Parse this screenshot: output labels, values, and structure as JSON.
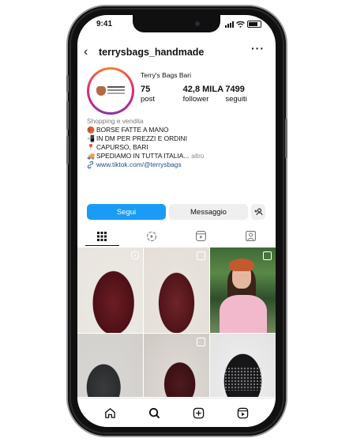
{
  "status_bar": {
    "time": "9:41"
  },
  "header": {
    "username": "terrysbags_handmade",
    "back_glyph": "‹",
    "more_glyph": "···"
  },
  "profile": {
    "display_name": "Terry's Bags Bari",
    "stats": [
      {
        "value": "75",
        "label": "post"
      },
      {
        "value": "42,8 MILA",
        "label": "follower"
      },
      {
        "value": "7499",
        "label": "seguiti"
      }
    ]
  },
  "bio": {
    "category": "Shopping e vendita",
    "lines": [
      {
        "emoji": "🏀",
        "text": "BORSE FATTE A MANO"
      },
      {
        "emoji": "📲",
        "text": "IN DM PER PREZZI E ORDINI"
      },
      {
        "emoji": "📍",
        "text": "CAPURSO, BARI"
      },
      {
        "emoji": "🚚",
        "text": "SPEDIAMO IN TUTTA ITALIA..."
      }
    ],
    "more_label": "altro",
    "link": "www.tiktok.com/@terrysbags"
  },
  "actions": {
    "follow": "Segui",
    "message": "Messaggio",
    "add_user": "+8"
  },
  "tabs": [
    "grid-icon",
    "reels-icon",
    "video-icon",
    "tagged-icon"
  ],
  "nav": [
    "home-icon",
    "search-icon",
    "create-icon",
    "reels-icon"
  ],
  "colors": {
    "accent": "#1a9cf5",
    "link": "#1b4f8a"
  }
}
